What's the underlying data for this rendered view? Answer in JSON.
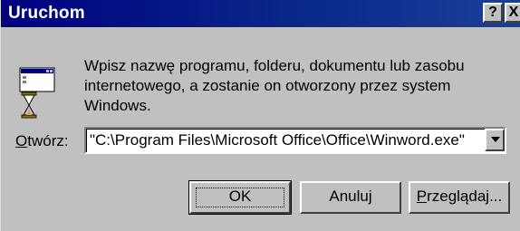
{
  "window": {
    "title": "Uruchom",
    "help_button": "?",
    "close_button": "X"
  },
  "message": {
    "line1": "Wpisz nazwę programu, folderu, dokumentu lub zasobu",
    "line2": "internetowego, a zostanie on otworzony przez system Windows."
  },
  "open_field": {
    "label_accel": "O",
    "label_rest": "twórz:",
    "value": "\"C:\\Program Files\\Microsoft Office\\Office\\Winword.exe\""
  },
  "buttons": {
    "ok": "OK",
    "cancel": "Anuluj",
    "browse_accel": "P",
    "browse_rest": "rzeglądaj..."
  },
  "icons": {
    "run": "run-program-icon",
    "dropdown": "dropdown-arrow-icon"
  }
}
